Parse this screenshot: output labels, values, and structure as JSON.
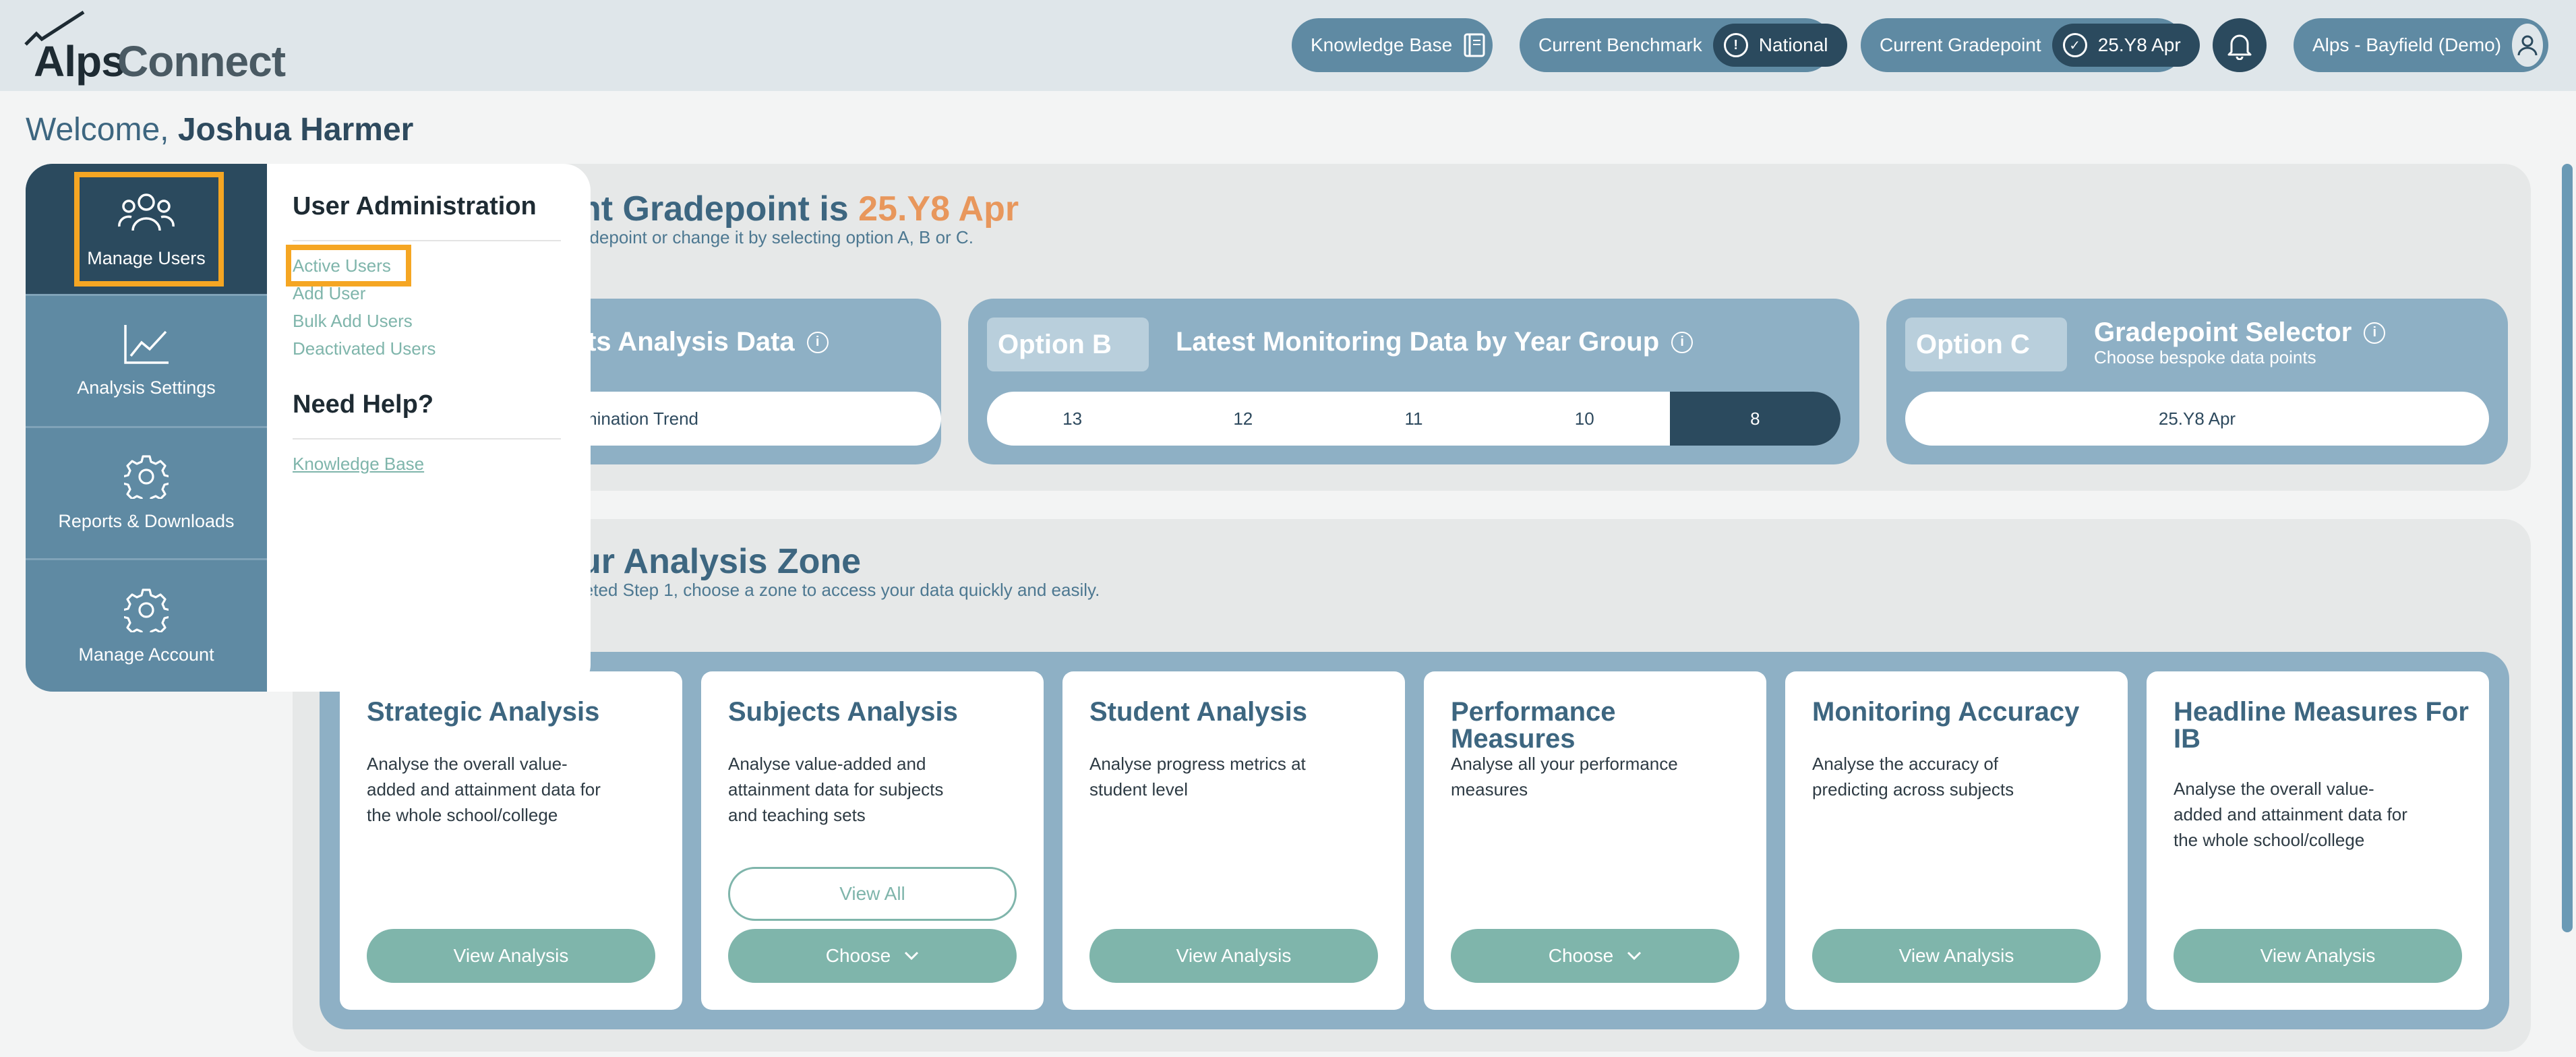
{
  "brand": {
    "part1": "Alps",
    "part2": "Connect"
  },
  "header": {
    "knowledge_base": "Knowledge Base",
    "benchmark_label": "Current Benchmark",
    "benchmark_value": "National",
    "gradepoint_label": "Current Gradepoint",
    "gradepoint_value": "25.Y8 Apr",
    "account": "Alps - Bayfield (Demo)"
  },
  "welcome": {
    "prefix": "Welcome,",
    "name": "Joshua Harmer"
  },
  "nav": {
    "items": [
      {
        "label": "Manage Users",
        "icon": "users-icon",
        "active": true
      },
      {
        "label": "Analysis Settings",
        "icon": "chart-line-icon"
      },
      {
        "label": "Reports & Downloads",
        "icon": "gear-icon"
      },
      {
        "label": "Manage Account",
        "icon": "gear-icon"
      }
    ]
  },
  "flyout": {
    "heading1": "User Administration",
    "links": [
      "Active Users",
      "Add User",
      "Bulk Add Users",
      "Deactivated Users"
    ],
    "heading2": "Need Help?",
    "help_link": "Knowledge Base"
  },
  "gradepoint": {
    "title_partial": "nt Gradepoint is",
    "title_value": "25.Y8 Apr",
    "subtitle_partial": "adepoint or change it by selecting option A, B or C."
  },
  "option_a": {
    "title_partial": "lts Analysis Data",
    "value_partial": "mination Trend"
  },
  "option_b": {
    "tag": "Option B",
    "title": "Latest Monitoring Data by Year Group",
    "years": [
      "13",
      "12",
      "11",
      "10",
      "8"
    ],
    "active_year": "8"
  },
  "option_c": {
    "tag": "Option C",
    "title": "Gradepoint Selector",
    "subtitle": "Choose bespoke data points",
    "value": "25.Y8 Apr"
  },
  "zone": {
    "title_partial": "ur Analysis Zone",
    "subtitle_partial": "leted Step 1, choose a zone to access your data quickly and easily."
  },
  "cards": [
    {
      "title": "Strategic Analysis",
      "desc": "Analyse the overall value-added and attainment data for the whole school/college",
      "button": "View Analysis"
    },
    {
      "title": "Subjects Analysis",
      "desc": "Analyse value-added and attainment data for subjects and teaching sets",
      "secondary": "View All",
      "button": "Choose"
    },
    {
      "title": "Student Analysis",
      "desc": "Analyse progress metrics at student level",
      "button": "View Analysis"
    },
    {
      "title": "Performance Measures",
      "desc": "Analyse all your performance measures",
      "button": "Choose"
    },
    {
      "title": "Monitoring Accuracy",
      "desc": "Analyse the accuracy of predicting across subjects",
      "button": "View Analysis"
    },
    {
      "title": "Headline Measures For IB",
      "desc": "Analyse the overall value-added and attainment data for the whole school/college",
      "button": "View Analysis"
    }
  ],
  "colors": {
    "accent_orange": "#e8975c",
    "nav_dark": "#2b4a5e",
    "nav": "#5f8aa3",
    "teal_button": "#7fb5ab",
    "highlight": "#f5a623"
  }
}
